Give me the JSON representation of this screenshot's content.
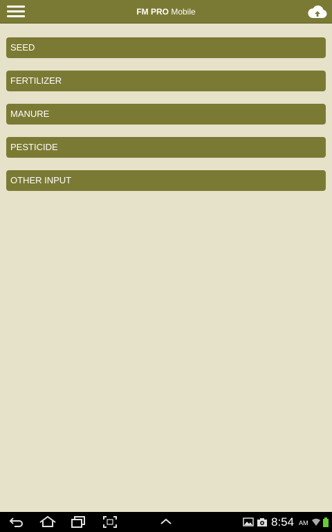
{
  "app_bar": {
    "title_bold": "FM PRO",
    "title_rest": " Mobile",
    "menu_icon": "hamburger-menu-icon",
    "sync_icon": "cloud-sync-icon"
  },
  "menu": {
    "items": [
      {
        "label": "SEED"
      },
      {
        "label": "FERTILIZER"
      },
      {
        "label": "MANURE"
      },
      {
        "label": "PESTICIDE"
      },
      {
        "label": "OTHER INPUT"
      }
    ]
  },
  "system_bar": {
    "time": "8:54",
    "ampm": "AM",
    "icons": [
      "back-icon",
      "home-icon",
      "recent-apps-icon",
      "screenshot-icon",
      "chevron-up-icon",
      "image-notification-icon",
      "camera-notification-icon",
      "wifi-icon",
      "battery-icon"
    ]
  },
  "colors": {
    "bar": "#7b7a34",
    "background": "#e6e1c9",
    "text": "#ffffff"
  }
}
